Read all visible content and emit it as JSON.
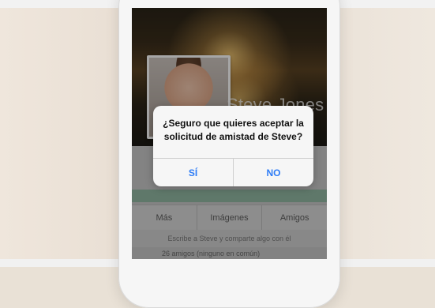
{
  "profile": {
    "name": "Steve Jones"
  },
  "tabs": [
    "Más",
    "Imágenes",
    "Amigos"
  ],
  "compose_placeholder": "Escribe a Steve y comparte algo con él",
  "friends_summary": "26 amigos (ninguno en común)",
  "dialog": {
    "message": "¿Seguro que quieres aceptar la solicitud de amistad de Steve?",
    "buttons": {
      "yes_label": "SÍ",
      "no_label": "NO"
    },
    "button_color": "#2d7cf6"
  },
  "colors": {
    "green_band": "#8ab59c"
  }
}
